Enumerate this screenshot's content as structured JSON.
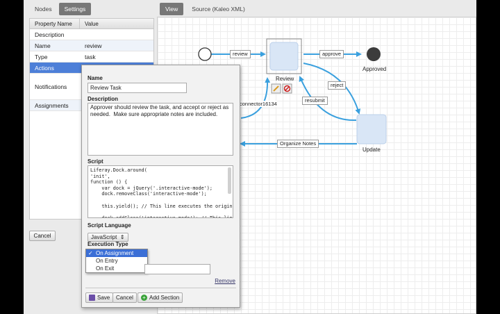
{
  "left_tabs": {
    "nodes": "Nodes",
    "settings": "Settings"
  },
  "right_tabs": {
    "view": "View",
    "source": "Source (Kaleo XML)"
  },
  "properties": {
    "header": {
      "name": "Property Name",
      "value": "Value"
    },
    "rows": [
      {
        "name": "Description",
        "value": ""
      },
      {
        "name": "Name",
        "value": "review"
      },
      {
        "name": "Type",
        "value": "task"
      },
      {
        "name": "Actions",
        "value": ""
      },
      {
        "name": "Notifications",
        "value": ""
      },
      {
        "name": "Assignments",
        "value": ""
      }
    ]
  },
  "footer": {
    "cancel": "Cancel"
  },
  "editor": {
    "name_label": "Name",
    "name_value": "Review Task",
    "description_label": "Description",
    "description_value": "Approver should review the task, and accept or reject as needed.  Make sure appropriate notes are included.",
    "script_label": "Script",
    "script_value": "Liferay.Dock.around(\n'init',\nfunction () {\n    var dock = jQuery('.interactive-mode');\n    dock.removeClass('interactive-mode');\n\n    this.yield(); // This line executes the original function\n\n    dock.addClass('interactive-mode'); // This line now adds",
    "script_language_label": "Script Language",
    "script_language_value": "JavaScript",
    "execution_type_label": "Execution Type",
    "execution_options": [
      "On Assignment",
      "On Entry",
      "On Exit"
    ],
    "execution_selected": "On Assignment",
    "remove_label": "Remove",
    "save_label": "Save",
    "cancel_label": "Cancel",
    "add_section_label": "Add Section"
  },
  "workflow": {
    "nodes": {
      "review": "Review",
      "approved": "Approved",
      "update": "Update"
    },
    "connectors": {
      "review": "review",
      "approve": "approve",
      "reject": "reject",
      "resubmit": "resubmit",
      "organize_notes": "Organize Notes",
      "connector": "connector16134"
    }
  },
  "colors": {
    "selection": "#4d7fd8",
    "connector": "#3aa0de",
    "task_fill": "#d9e6f6"
  }
}
